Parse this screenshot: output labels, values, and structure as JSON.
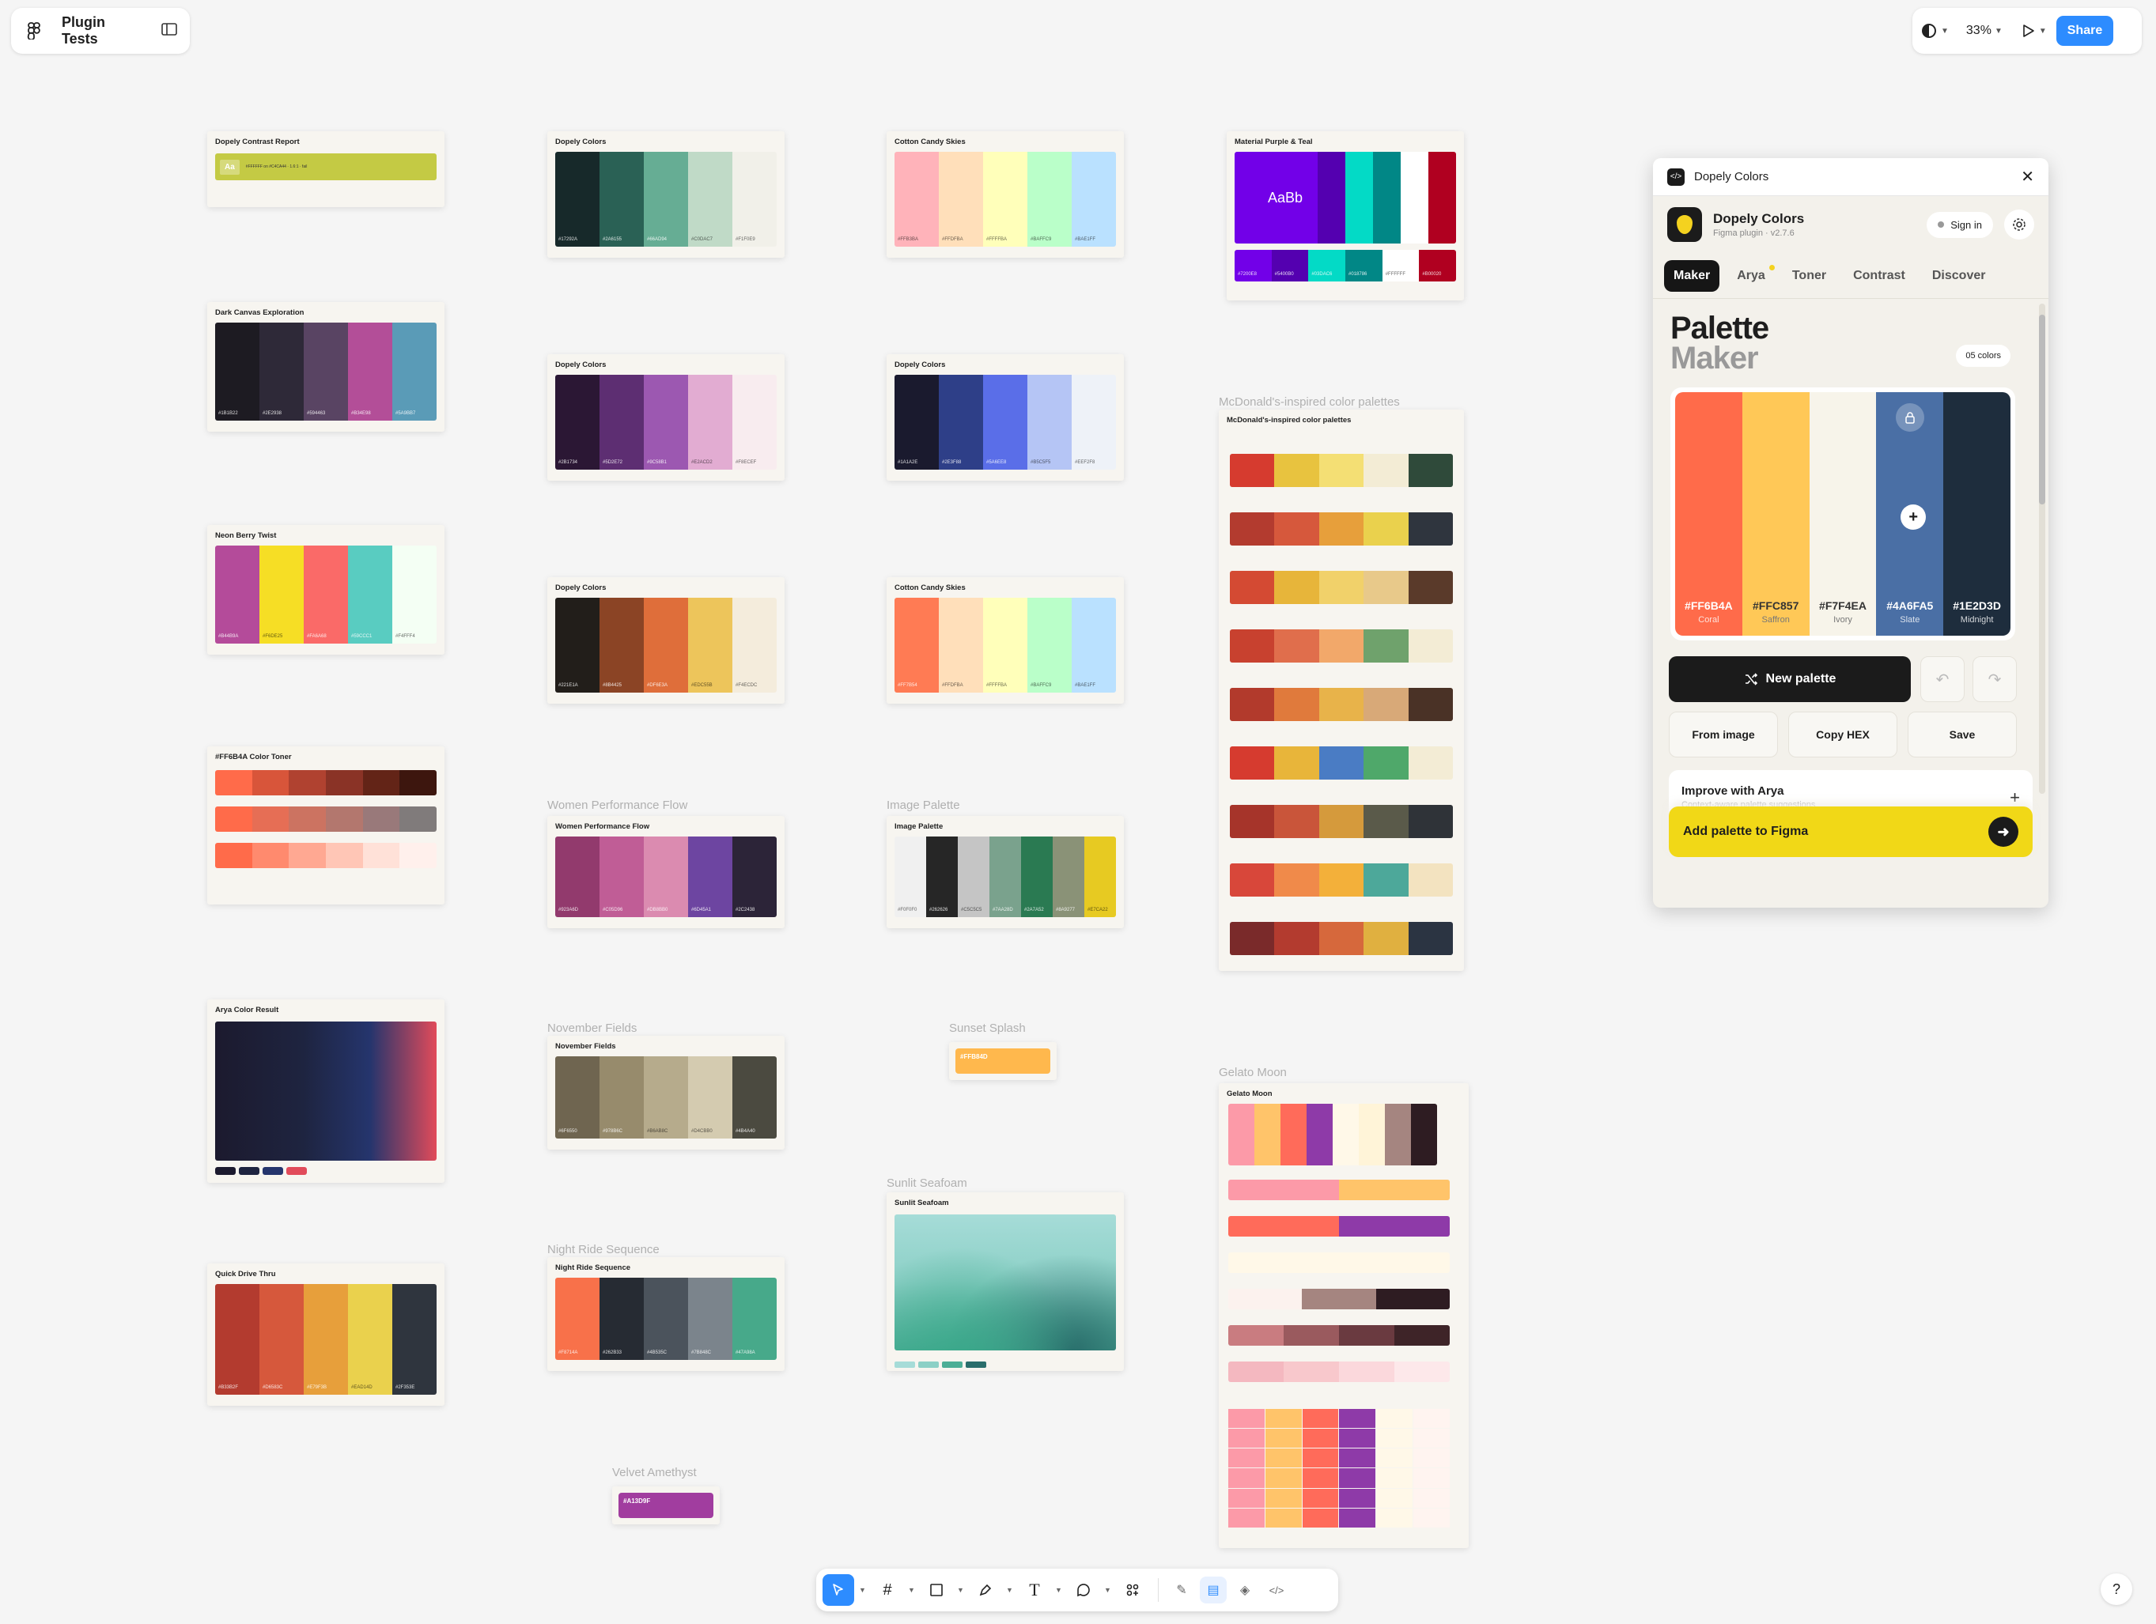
{
  "topbar": {
    "file_name": "Plugin Tests",
    "zoom": "33%",
    "share_label": "Share"
  },
  "frames": [
    {
      "label": "Dopely Contrast Report",
      "title": "Dopely Contrast Report",
      "badge": "Aa",
      "contrast_text": "#FFFFFF on #C4CA44 · 1.6:1 · fail",
      "color": "#c4ca44"
    },
    {
      "label": "Dark Canvas Exploration",
      "title": "Dark Canvas Exploration",
      "colors": [
        "#1d1b22",
        "#2e2938",
        "#594463",
        "#b34e98",
        "#5a9bb7"
      ],
      "hex": [
        "#1B1B22",
        "#2E2938",
        "#594463",
        "#B34E98",
        "#5A9BB7"
      ]
    },
    {
      "label": "Neon Berry Twist",
      "title": "Neon Berry Twist",
      "colors": [
        "#b44b9a",
        "#f6de25",
        "#fa6a68",
        "#59ccc1",
        "#f4fff4"
      ],
      "hex": [
        "#B44B9A",
        "#F6DE25",
        "#FA6A68",
        "#59CCC1",
        "#F4FFF4"
      ]
    },
    {
      "label": "#FF6B4A Color Toner",
      "title": "#FF6B4A Color Toner"
    },
    {
      "label": "Arya Color Result",
      "title": "Arya Color Result"
    },
    {
      "label": "Quick Drive Thru",
      "title": "Quick Drive Thru",
      "colors": [
        "#b33b2f",
        "#d6583c",
        "#e79f3b",
        "#ead14d",
        "#2f353e"
      ],
      "hex": [
        "#B33B2F",
        "#D6583C",
        "#E79F3B",
        "#EAD14D",
        "#2F353E"
      ]
    },
    {
      "label": "Dopely Colors · Palette Maker",
      "title": "Dopely Colors",
      "colors": [
        "#17292a",
        "#2a6155",
        "#66ad94",
        "#c0dac7",
        "#f1f0e9"
      ],
      "hex": [
        "#17292A",
        "#2A6155",
        "#66AD94",
        "#C0DAC7",
        "#F1F0E9"
      ]
    },
    {
      "label": "Dopely Colors · Palette Maker",
      "title": "Dopely Colors",
      "colors": [
        "#2b1734",
        "#5d2e72",
        "#9c58b1",
        "#e2acd2",
        "#f8ecef"
      ],
      "hex": [
        "#2B1734",
        "#5D2E72",
        "#9C58B1",
        "#E2ACD2",
        "#F8ECEF"
      ]
    },
    {
      "label": "Dopely Colors · Palette Maker",
      "title": "Dopely Colors",
      "colors": [
        "#221e1a",
        "#8b4425",
        "#df6e3a",
        "#edc55b",
        "#f4ecdc"
      ],
      "hex": [
        "#221E1A",
        "#8B4425",
        "#DF6E3A",
        "#EDC55B",
        "#F4ECDC"
      ]
    },
    {
      "label": "Women Performance Flow",
      "title": "Women Performance Flow",
      "colors": [
        "#923a6d",
        "#c05d96",
        "#db8bb0",
        "#6d45a1",
        "#2c2438"
      ],
      "hex": [
        "#923A6D",
        "#C05D96",
        "#DB8BB0",
        "#6D45A1",
        "#2C2438"
      ]
    },
    {
      "label": "November Fields",
      "title": "November Fields",
      "colors": [
        "#6f6550",
        "#978b6c",
        "#b6ab8c",
        "#d4cbb0",
        "#4b4a40"
      ],
      "hex": [
        "#6F6550",
        "#978B6C",
        "#B6AB8C",
        "#D4CBB0",
        "#4B4A40"
      ]
    },
    {
      "label": "Night Ride Sequence",
      "title": "Night Ride Sequence",
      "colors": [
        "#f8714a",
        "#262b33",
        "#4b535c",
        "#7b848c",
        "#47a98a"
      ],
      "hex": [
        "#F8714A",
        "#262B33",
        "#4B535C",
        "#7B848C",
        "#47A98A"
      ]
    },
    {
      "label": "Velvet Amethyst",
      "hex": "#A13D9F",
      "color": "#a13d9f"
    },
    {
      "label": "Cotton Candy Skies",
      "title": "Cotton Candy Skies",
      "colors": [
        "#ffb3ba",
        "#ffdfba",
        "#ffffba",
        "#baffc9",
        "#bae1ff"
      ],
      "hex": [
        "#FFB3BA",
        "#FFDFBA",
        "#FFFFBA",
        "#BAFFC9",
        "#BAE1FF"
      ]
    },
    {
      "label": "Dopely Colors · Palette Maker",
      "title": "Dopely Colors",
      "colors": [
        "#1a1a2e",
        "#2e3f88",
        "#5a6ee8",
        "#b5c5f5",
        "#eef2f8"
      ],
      "hex": [
        "#1A1A2E",
        "#2E3F88",
        "#5A6EE8",
        "#B5C5F5",
        "#EEF2F8"
      ]
    },
    {
      "label": "Cotton Candy Skies",
      "title": "Cotton Candy Skies",
      "colors": [
        "#ff7b54",
        "#ffdfba",
        "#ffffba",
        "#baffc9",
        "#bae1ff"
      ],
      "hex": [
        "#FF7B54",
        "#FFDFBA",
        "#FFFFBA",
        "#BAFFC9",
        "#BAE1FF"
      ]
    },
    {
      "label": "Image Palette",
      "title": "Image Palette",
      "colors": [
        "#f0f0f0",
        "#262626",
        "#c5c5c5",
        "#7aa28d",
        "#2a7a52",
        "#8a9277",
        "#e7ca22"
      ],
      "hex": [
        "#F0F0F0",
        "#262626",
        "#C5C5C5",
        "#7AA28D",
        "#2A7A52",
        "#8A9277",
        "#E7CA22"
      ]
    },
    {
      "label": "Sunset Splash",
      "hex": "#FFB84D",
      "color": "#ffb84d"
    },
    {
      "label": "Sunlit Seafoam",
      "title": "Sunlit Seafoam"
    },
    {
      "label": "Material Purple & Teal",
      "title": "Material Purple & Teal",
      "sample": "AaBb",
      "colors": [
        "#7200e8",
        "#5400b0",
        "#03dac6",
        "#018786",
        "#ffffff",
        "#b00020"
      ],
      "hex": [
        "#7200E8",
        "#5400B0",
        "#03DAC6",
        "#018786",
        "#FFFFFF",
        "#B00020"
      ]
    },
    {
      "label": "McDonald's-inspired color palettes",
      "title": "McDonald's-inspired color palettes"
    },
    {
      "label": "Gelato Moon",
      "title": "Gelato Moon"
    }
  ],
  "mcd_rows": [
    [
      "#d63b2f",
      "#e8c33f",
      "#f4df74",
      "#f3ecd5",
      "#2f4a3a"
    ],
    [
      "#b33b2f",
      "#d6583c",
      "#e79f3b",
      "#ead14d",
      "#2f353e"
    ],
    [
      "#d44a33",
      "#e7b53a",
      "#f1d16a",
      "#e8c98a",
      "#5a3a2a"
    ],
    [
      "#c8412f",
      "#e06e4c",
      "#f2a86a",
      "#6fa26c",
      "#f3ecd5"
    ],
    [
      "#b23a2c",
      "#e07a3c",
      "#e8b34a",
      "#d8a978",
      "#4a3226"
    ],
    [
      "#d63b2f",
      "#e8b53a",
      "#4a7cc4",
      "#4fa86a",
      "#f3ecd5"
    ],
    [
      "#a6342a",
      "#c9553a",
      "#d59a3c",
      "#5a5a4a",
      "#2f3338"
    ],
    [
      "#d8473a",
      "#f08a4a",
      "#f3b03a",
      "#4da89a",
      "#f3e3c0"
    ],
    [
      "#7a2a2a",
      "#b33b2f",
      "#d6683c",
      "#e0b040",
      "#2b3442"
    ]
  ],
  "plugin": {
    "header_title": "Dopely Colors",
    "app_name": "Dopely Colors",
    "app_subtitle": "Figma plugin · v2.7.6",
    "signin": "Sign in",
    "tabs": [
      "Maker",
      "Arya",
      "Toner",
      "Contrast",
      "Discover"
    ],
    "title_line1": "Palette",
    "title_line2": "Maker",
    "count": "05 colors",
    "palette": [
      {
        "hex": "#FF6B4A",
        "name": "Coral",
        "color": "#ff6b4a"
      },
      {
        "hex": "#FFC857",
        "name": "Saffron",
        "color": "#ffc857"
      },
      {
        "hex": "#F7F4EA",
        "name": "Ivory",
        "color": "#f7f4ea"
      },
      {
        "hex": "#4A6FA5",
        "name": "Slate",
        "color": "#4a6fa5"
      },
      {
        "hex": "#1E2D3D",
        "name": "Midnight",
        "color": "#1e2d3d"
      }
    ],
    "new_palette": "New palette",
    "from_image": "From image",
    "copy_hex": "Copy HEX",
    "save": "Save",
    "improve_title": "Improve with Arya",
    "improve_sub": "Context-aware palette suggestions",
    "add_to_figma": "Add palette to Figma"
  },
  "help": "?"
}
